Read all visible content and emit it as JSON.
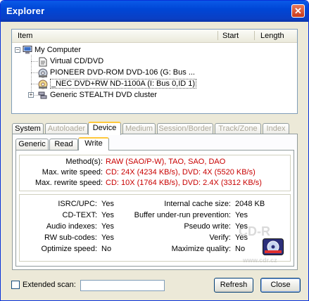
{
  "window": {
    "title": "Explorer",
    "close_glyph": "✕"
  },
  "tree": {
    "columns": [
      "Item",
      "Start",
      "Length"
    ],
    "root": {
      "label": "My Computer",
      "expander": "−",
      "icon": "computer-icon"
    },
    "children": [
      {
        "label": "Virtual CD/DVD",
        "icon": "document-icon"
      },
      {
        "label": "PIONEER DVD-ROM DVD-106 (G: Bus ...",
        "icon": "drive-icon"
      },
      {
        "label": "_NEC DVD+RW ND-1100A (I: Bus 0,ID 1)",
        "icon": "drive-icon",
        "selected": true
      },
      {
        "label": "Generic STEALTH DVD cluster",
        "icon": "cluster-icon",
        "expander": "+"
      }
    ]
  },
  "tabs": [
    {
      "label": "System",
      "disabled": false
    },
    {
      "label": "Autoloader",
      "disabled": true
    },
    {
      "label": "Device",
      "active": true
    },
    {
      "label": "Medium",
      "disabled": true
    },
    {
      "label": "Session/Border",
      "disabled": true
    },
    {
      "label": "Track/Zone",
      "disabled": true
    },
    {
      "label": "Index",
      "disabled": true
    }
  ],
  "subtabs": [
    {
      "label": "Generic"
    },
    {
      "label": "Read"
    },
    {
      "label": "Write",
      "active": true
    }
  ],
  "write_info": [
    {
      "label": "Method(s):",
      "value": "RAW (SAO/P-W), TAO, SAO, DAO"
    },
    {
      "label": "Max. write speed:",
      "value": "CD: 24X (4234 KB/s), DVD: 4X (5520 KB/s)"
    },
    {
      "label": "Max. rewrite speed:",
      "value": "CD: 10X (1764 KB/s), DVD: 2.4X (3312 KB/s)"
    }
  ],
  "features_left": [
    {
      "label": "ISRC/UPC:",
      "value": "Yes"
    },
    {
      "label": "CD-TEXT:",
      "value": "Yes"
    },
    {
      "label": "Audio indexes:",
      "value": "Yes"
    },
    {
      "label": "RW sub-codes:",
      "value": "Yes"
    },
    {
      "label": "Optimize speed:",
      "value": "No"
    }
  ],
  "features_right": [
    {
      "label": "Internal cache size:",
      "value": "2048 KB"
    },
    {
      "label": "Buffer under-run prevention:",
      "value": "Yes"
    },
    {
      "label": "Pseudo write:",
      "value": "Yes"
    },
    {
      "label": "Verify:",
      "value": "Yes"
    },
    {
      "label": "Maximize quality:",
      "value": "No"
    }
  ],
  "watermark": {
    "brand": "CD-R",
    "url": "www.cdr.cz"
  },
  "footer": {
    "extended_scan_label": "Extended scan:",
    "extended_scan_checked": false,
    "extended_scan_value": "",
    "refresh_label": "Refresh",
    "close_label": "Close"
  },
  "colors": {
    "title_bar": "#0a4fd8",
    "accent_tab": "#ffc83c",
    "value_red": "#c80000"
  }
}
